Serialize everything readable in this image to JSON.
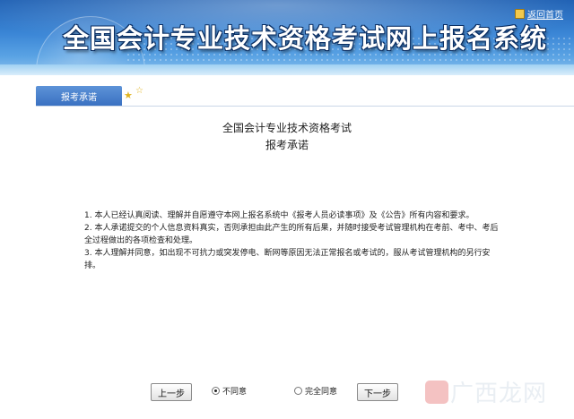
{
  "header": {
    "title": "全国会计专业技术资格考试网上报名系统",
    "home_link": "返回首页"
  },
  "tab": {
    "label": "报考承诺"
  },
  "page": {
    "title_line1": "全国会计专业技术资格考试",
    "title_line2": "报考承诺"
  },
  "terms": [
    "1. 本人已经认真阅读、理解并自愿遵守本网上报名系统中《报考人员必读事项》及《公告》所有内容和要求。",
    "2. 本人承诺提交的个人信息资料真实，否则承担由此产生的所有后果，并随时接受考试管理机构在考前、考中、考后全过程做出的各项检查和处理。",
    "3. 本人理解并同意，如出现不可抗力或突发停电、断网等原因无法正常报名或考试的，服从考试管理机构的另行安排。"
  ],
  "controls": {
    "prev_label": "上一步",
    "disagree_label": "不同意",
    "agree_label": "完全同意",
    "next_label": "下一步",
    "selected": "disagree"
  },
  "watermark": "广西龙网",
  "colors": {
    "banner": "#3b86d6",
    "tab": "#4a82cc",
    "star": "#e0b420"
  }
}
